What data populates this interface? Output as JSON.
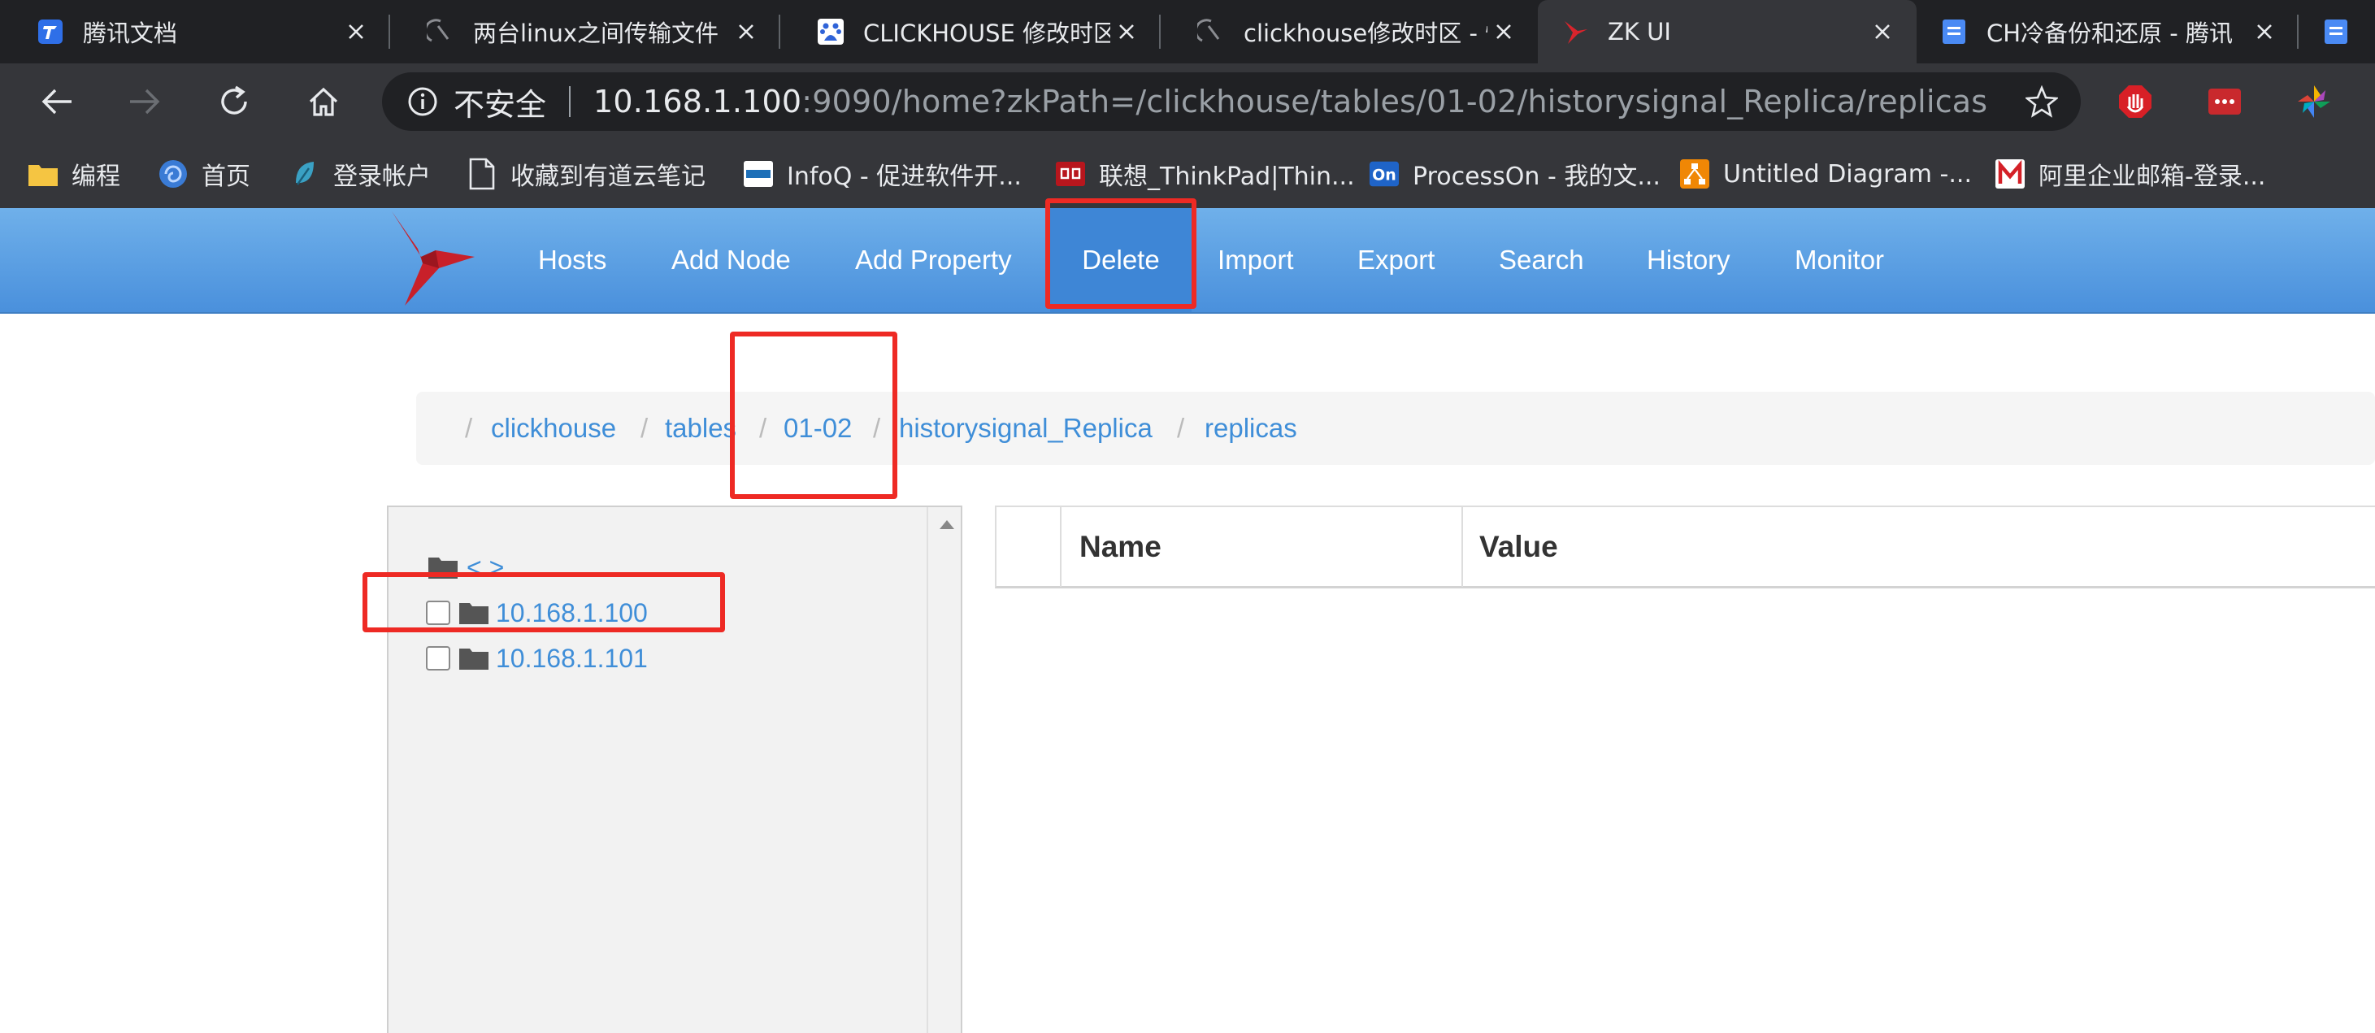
{
  "browser": {
    "tabs": [
      {
        "title": "腾讯文档",
        "icon": "tencent-docs-icon"
      },
      {
        "title": "两台linux之间传输文件",
        "icon": "spinner-icon"
      },
      {
        "title": "CLICKHOUSE 修改时区",
        "icon": "baidu-icon"
      },
      {
        "title": "clickhouse修改时区 - 懒",
        "icon": "spinner-icon"
      },
      {
        "title": "ZK UI",
        "icon": "zkui-bird-icon",
        "active": true
      },
      {
        "title": "CH冷备份和还原 - 腾讯",
        "icon": "docs-icon"
      }
    ],
    "address": {
      "security_label": "不安全",
      "host": "10.168.1.100",
      "rest": ":9090/home?zkPath=/clickhouse/tables/01-02/historysignal_Replica/replicas"
    },
    "bookmarks": [
      {
        "label": "编程",
        "icon": "folder-icon"
      },
      {
        "label": "首页",
        "icon": "swirl-icon"
      },
      {
        "label": "登录帐户",
        "icon": "leaf-icon"
      },
      {
        "label": "收藏到有道云笔记",
        "icon": "page-icon"
      },
      {
        "label": "InfoQ - 促进软件开...",
        "icon": "infoq-icon"
      },
      {
        "label": "联想_ThinkPad|Thin...",
        "icon": "lenovo-icon"
      },
      {
        "label": "ProcessOn - 我的文...",
        "icon": "processon-icon"
      },
      {
        "label": "Untitled Diagram -...",
        "icon": "drawio-icon"
      },
      {
        "label": "阿里企业邮箱-登录...",
        "icon": "mail-icon"
      }
    ]
  },
  "app": {
    "nav": [
      "Hosts",
      "Add Node",
      "Add Property",
      "Delete",
      "Import",
      "Export",
      "Search",
      "History",
      "Monitor"
    ],
    "active_nav": "Delete",
    "breadcrumb": [
      "clickhouse",
      "tables",
      "01-02",
      "historysignal_Replica",
      "replicas"
    ],
    "tree": {
      "parent_label": "<  >",
      "nodes": [
        "10.168.1.100",
        "10.168.1.101"
      ]
    },
    "table": {
      "columns": [
        "Name",
        "Value"
      ]
    }
  },
  "colors": {
    "nav_gradient_top": "#6fb0ea",
    "nav_gradient_bottom": "#4a90dc",
    "link": "#3f8ed8",
    "annotation": "#ee2a24"
  }
}
